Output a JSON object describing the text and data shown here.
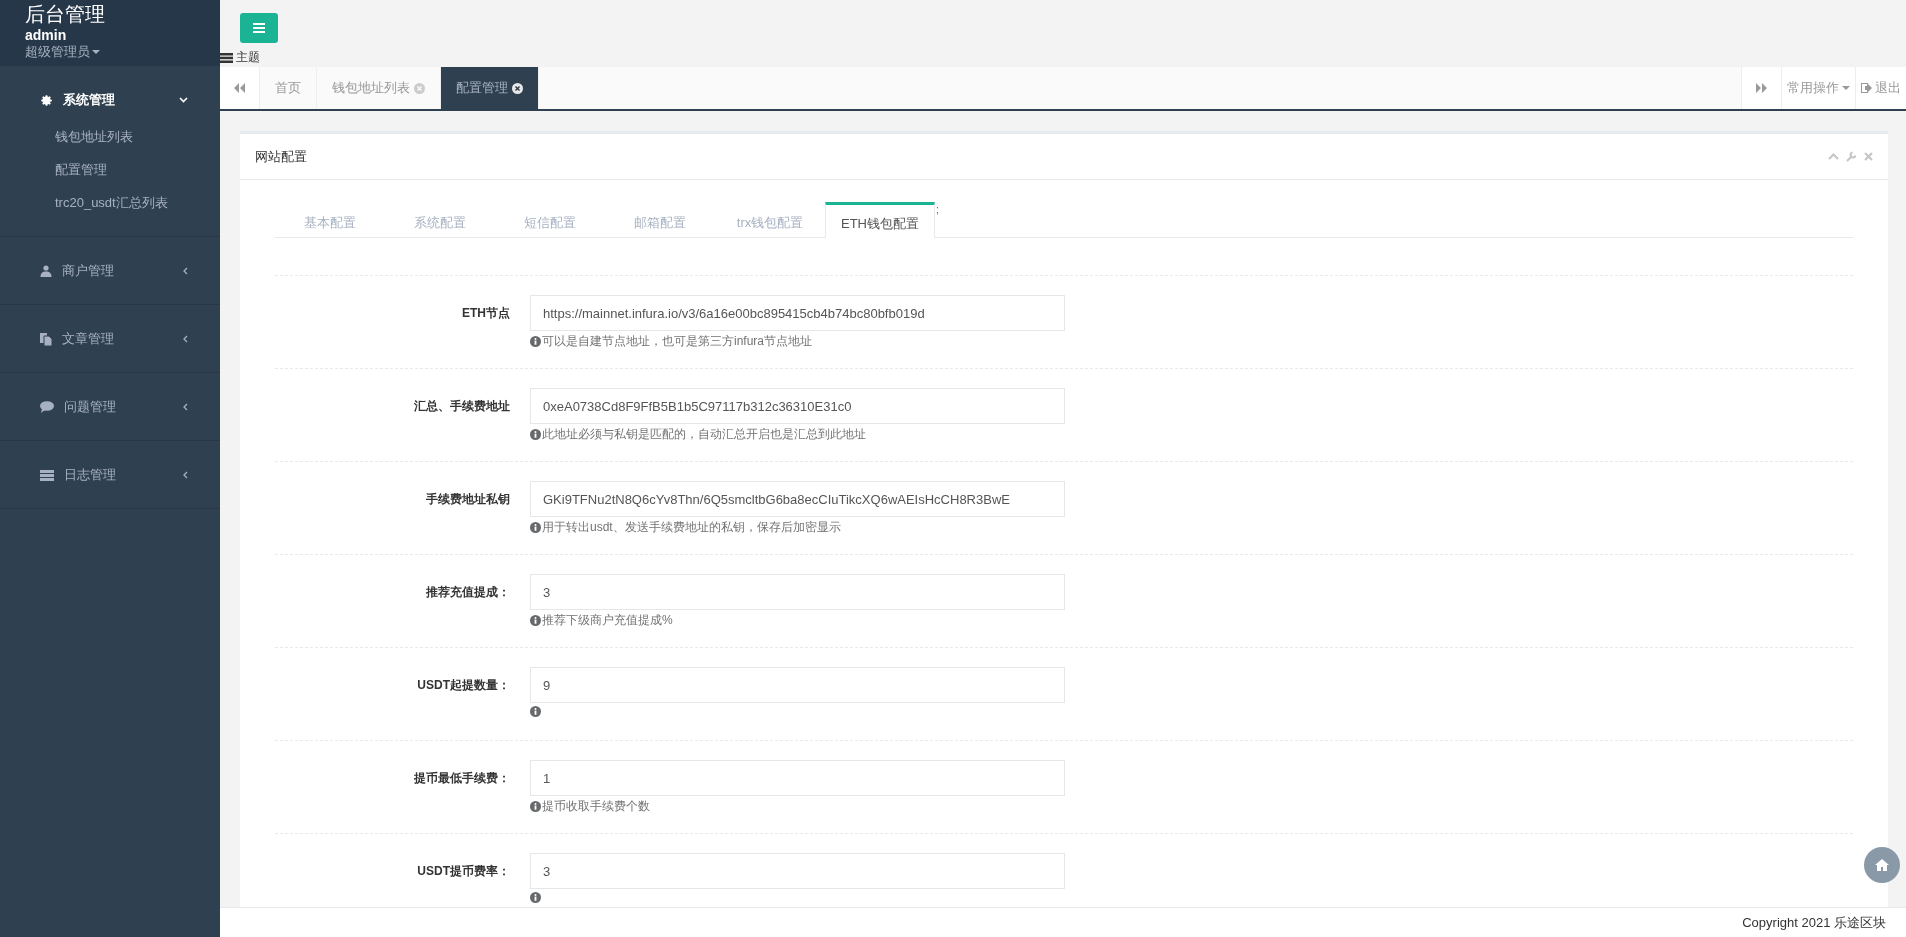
{
  "sidebar": {
    "brand": "后台管理",
    "user": "admin",
    "role": "超级管理员",
    "menu": [
      {
        "label": "系统管理",
        "expanded": true,
        "children": [
          {
            "label": "钱包地址列表"
          },
          {
            "label": "配置管理"
          },
          {
            "label": "trc20_usdt汇总列表"
          }
        ]
      },
      {
        "label": "商户管理",
        "expanded": false
      },
      {
        "label": "文章管理",
        "expanded": false
      },
      {
        "label": "问题管理",
        "expanded": false
      },
      {
        "label": "日志管理",
        "expanded": false
      }
    ]
  },
  "topbar": {
    "theme_label": "主题"
  },
  "page_tabs": [
    {
      "label": "首页",
      "closable": false,
      "selected": false
    },
    {
      "label": "钱包地址列表",
      "closable": true,
      "selected": false
    },
    {
      "label": "配置管理",
      "closable": true,
      "selected": true
    }
  ],
  "tab_actions": {
    "common_ops": "常用操作",
    "logout": "退出"
  },
  "card": {
    "title": "网站配置",
    "tabs": [
      {
        "label": "基本配置",
        "selected": false
      },
      {
        "label": "系统配置",
        "selected": false
      },
      {
        "label": "短信配置",
        "selected": false
      },
      {
        "label": "邮箱配置",
        "selected": false
      },
      {
        "label": "trx钱包配置",
        "selected": false
      },
      {
        "label": "ETH钱包配置",
        "selected": true
      }
    ],
    "stray_mark": ";",
    "fields": [
      {
        "label": "ETH节点",
        "value": "https://mainnet.infura.io/v3/6a16e00bc895415cb4b74bc80bfb019d",
        "help": "可以是自建节点地址，也可是第三方infura节点地址"
      },
      {
        "label": "汇总、手续费地址",
        "value": "0xeA0738Cd8F9FfB5B1b5C97117b312c36310E31c0",
        "help": "此地址必须与私钥是匹配的，自动汇总开启也是汇总到此地址"
      },
      {
        "label": "手续费地址私钥",
        "value": "GKi9TFNu2tN8Q6cYv8Thn/6Q5smcltbG6ba8ecCIuTikcXQ6wAEIsHcCH8R3BwE",
        "help": "用于转出usdt、发送手续费地址的私钥，保存后加密显示"
      },
      {
        "label": "推荐充值提成：",
        "value": "3",
        "help": "推荐下级商户充值提成%"
      },
      {
        "label": "USDT起提数量：",
        "value": "9"
      },
      {
        "label": "提币最低手续费：",
        "value": "1",
        "help": "提币收取手续费个数"
      },
      {
        "label": "USDT提币费率：",
        "value": "3"
      }
    ]
  },
  "footer": {
    "copyright": "Copyright 2021 乐途区块"
  }
}
